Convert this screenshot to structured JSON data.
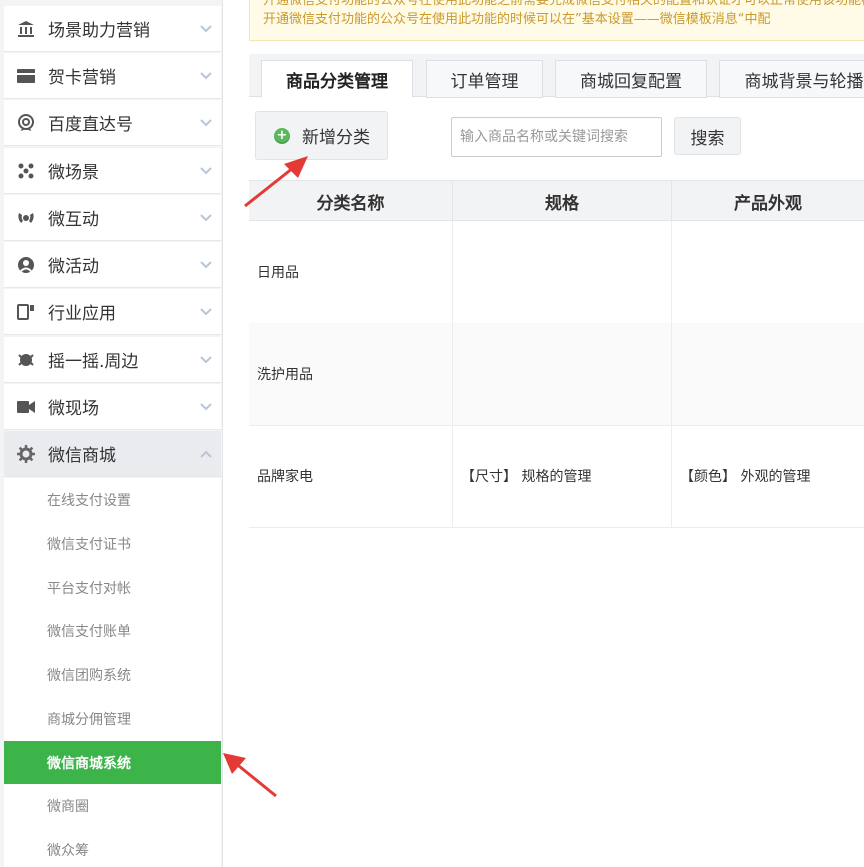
{
  "sidebar": {
    "menus": [
      {
        "label": "场景助力营销",
        "icon": "bank-icon",
        "chevron": "down"
      },
      {
        "label": "贺卡营销",
        "icon": "card-icon",
        "chevron": "down"
      },
      {
        "label": "百度直达号",
        "icon": "badge-icon",
        "chevron": "down"
      },
      {
        "label": "微场景",
        "icon": "dots-icon",
        "chevron": "down"
      },
      {
        "label": "微互动",
        "icon": "interact-icon",
        "chevron": "down"
      },
      {
        "label": "微活动",
        "icon": "activity-icon",
        "chevron": "down"
      },
      {
        "label": "行业应用",
        "icon": "app-icon",
        "chevron": "down"
      },
      {
        "label": "摇一摇.周边",
        "icon": "shake-icon",
        "chevron": "down"
      },
      {
        "label": "微现场",
        "icon": "video-icon",
        "chevron": "down"
      },
      {
        "label": "微信商城",
        "icon": "gear-icon",
        "chevron": "up"
      }
    ],
    "submenu": [
      {
        "label": "在线支付设置"
      },
      {
        "label": "微信支付证书"
      },
      {
        "label": "平台支付对帐"
      },
      {
        "label": "微信支付账单"
      },
      {
        "label": "微信团购系统"
      },
      {
        "label": "商城分佣管理"
      },
      {
        "label": "微信商城系统"
      },
      {
        "label": "微商圈"
      },
      {
        "label": "微众筹"
      }
    ],
    "accent_color": "#3cb44a"
  },
  "notice": {
    "line1": "开通微信支付功能的公众号在使用此功能之前需要完成微信支付相关的配置和认证才可以正常使用该功能模块请",
    "line2": "开通微信支付功能的公众号在使用此功能的时候可以在”基本设置——微信模板消息“中配"
  },
  "tabs": [
    {
      "label": "商品分类管理"
    },
    {
      "label": "订单管理"
    },
    {
      "label": "商城回复配置"
    },
    {
      "label": "商城背景与轮播"
    }
  ],
  "toolbar": {
    "add_label": "新增分类",
    "search_placeholder": "输入商品名称或关键词搜索",
    "search_button": "搜索"
  },
  "table": {
    "headers": [
      "分类名称",
      "规格",
      "产品外观"
    ],
    "rows": [
      {
        "name": "日用品",
        "spec": "",
        "appearance": ""
      },
      {
        "name": "洗护用品",
        "spec": "",
        "appearance": ""
      },
      {
        "name": "品牌家电",
        "spec": "【尺寸】 规格的管理",
        "appearance": "【颜色】 外观的管理"
      }
    ]
  }
}
